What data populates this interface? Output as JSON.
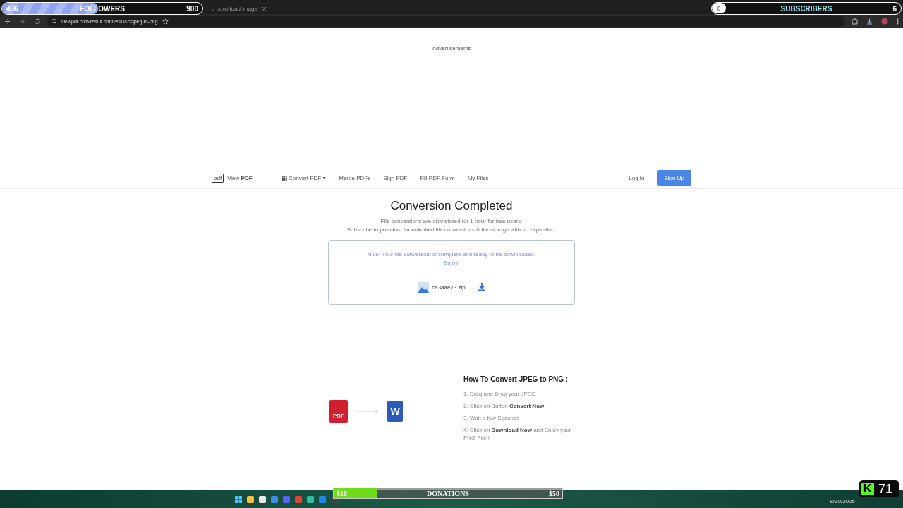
{
  "browser": {
    "tab_title": "d download image",
    "url": "viewpdf.com/result.html?e=0&c=jpeg-to-png"
  },
  "overlays": {
    "followers": {
      "count": "436",
      "label": "FOLLOWERS",
      "goal": "900",
      "level": 0.48
    },
    "subscribers": {
      "count": "0",
      "label": "SUBSCRIBERS",
      "goal": "6",
      "level": 0
    },
    "donations": {
      "current": "$10",
      "label": "DONATIONS",
      "goal": "$50",
      "level": 0.19
    },
    "viewer_badge": {
      "letter": "K",
      "count": "71"
    }
  },
  "ads_label": "Advertisements",
  "site_nav": {
    "logo_icon_text": "pdf",
    "logo": "View **PDF**",
    "items": [
      {
        "label": "Convert PDF",
        "kind": "dropdown"
      },
      {
        "label": "Merge PDFs",
        "kind": "link"
      },
      {
        "label": "Sign PDF",
        "kind": "link"
      },
      {
        "label": "Fill PDF Form",
        "kind": "link"
      },
      {
        "label": "My Files",
        "kind": "link"
      }
    ],
    "login": "Log In",
    "signup": "Sign Up"
  },
  "result": {
    "title": "Conversion Completed",
    "notes": [
      "File conversions are only stored for 1 hour for free users.",
      "Subscribe to premium for unlimited file conversions & file storage with no expiration."
    ],
    "message": "Nice! Your file conversion is complete and ready to be downloaded. Enjoy!",
    "file": "ca3aae73.zip"
  },
  "howto": {
    "pdf_badge": "PDF",
    "word_badge": "W",
    "title": "How To Convert JPEG to PNG :",
    "steps": [
      "1. Drag and Drop your JPEG",
      "2. Click on Button **Convert Now**",
      "3. Wait a few Seconds",
      "4. Click on **Download Now** and Enjoy your PNG File !"
    ]
  },
  "taskbar": {
    "date": "8/30/2025"
  }
}
